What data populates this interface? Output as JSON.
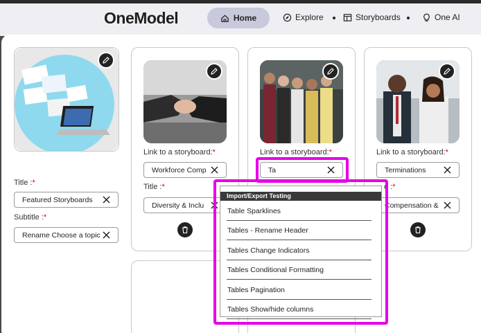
{
  "nav": {
    "logo": "OneModel",
    "home": "Home",
    "explore": "Explore",
    "storyboards": "Storyboards",
    "one_ai": "One AI"
  },
  "featured": {
    "title_label": "Title :",
    "title_value": "Featured Storyboards",
    "subtitle_label": "Subtitle :",
    "subtitle_value": "Rename Choose a topic"
  },
  "cards": [
    {
      "link_label": "Link to a storyboard:",
      "link_value": "Workforce Comp",
      "title_label": "Title :",
      "title_value": "Diversity & Inclu"
    },
    {
      "link_label": "Link to a storyboard:",
      "link_value": "Ta"
    },
    {
      "link_label": "Link to a storyboard:",
      "link_value": "Terminations",
      "title_label": "e :",
      "title_value": "Compensation &"
    }
  ],
  "required_marker": "*",
  "dropdown": {
    "header": "Import/Export Testing",
    "items": [
      "Table Sparklines",
      "Tables - Rename Header",
      "Tables Change Indicators",
      "Tables Conditional Formatting",
      "Tables Pagination",
      "Tables Show/hide columns"
    ]
  },
  "colors": {
    "highlight": "#e600e6",
    "nav_active": "#c9c9dd",
    "required": "#dd0000"
  }
}
